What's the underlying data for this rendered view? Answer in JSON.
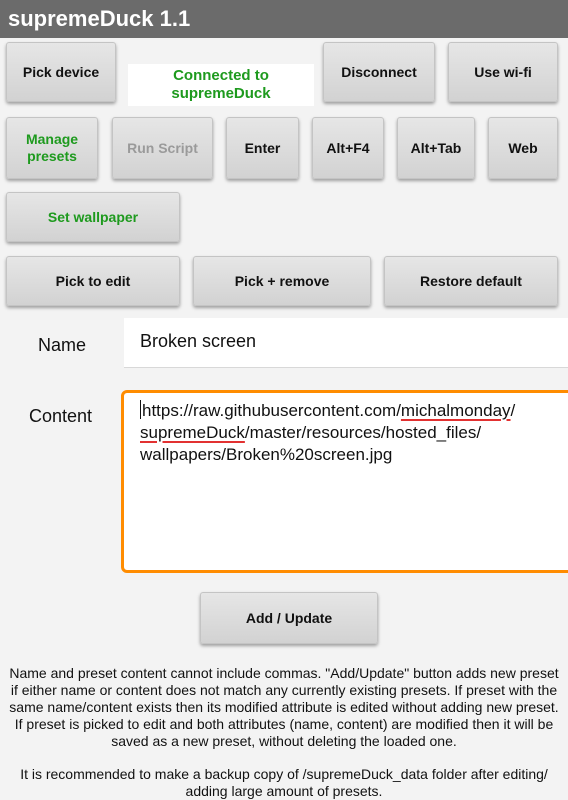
{
  "app": {
    "title": "supremeDuck 1.1"
  },
  "toolbar": {
    "pick_device": "Pick device",
    "connection_status_line1": "Connected to",
    "connection_status_line2": "supremeDuck",
    "disconnect": "Disconnect",
    "use_wifi": "Use wi-fi",
    "manage_presets_line1": "Manage",
    "manage_presets_line2": "presets",
    "run_script": "Run Script",
    "enter": "Enter",
    "alt_f4": "Alt+F4",
    "alt_tab": "Alt+Tab",
    "web": "Web",
    "set_wallpaper": "Set wallpaper",
    "pick_to_edit": "Pick to edit",
    "pick_remove": "Pick + remove",
    "restore_default": "Restore default"
  },
  "form": {
    "name_label": "Name",
    "name_value": "Broken screen",
    "content_label": "Content",
    "content_seg1": "https://raw.githubusercontent.com/",
    "content_seg2": "michalmonday",
    "content_seg3": "/",
    "content_seg4": "supremeDuck",
    "content_seg5": "/master/resources/hosted_files/",
    "content_seg6": "wallpapers/Broken%20screen.jpg",
    "add_update": "Add / Update"
  },
  "info": {
    "paragraph1": "Name and preset content cannot include commas. \"Add/Update\" button adds new preset if either name or content does not match any currently existing presets. If preset with the same name/content exists then its modified attribute is edited without adding new preset. If preset is picked to edit and both attributes (name, content) are modified then it will be saved as a new preset, without deleting the loaded one.",
    "paragraph2": "It is recommended to make a backup copy of /supremeDuck_data folder after editing/ adding large amount of presets."
  },
  "colors": {
    "accent_green": "#1e9a1e",
    "focus_orange": "#ff8c00",
    "titlebar": "#6b6b6b",
    "spellcheck_red": "#e23131"
  }
}
